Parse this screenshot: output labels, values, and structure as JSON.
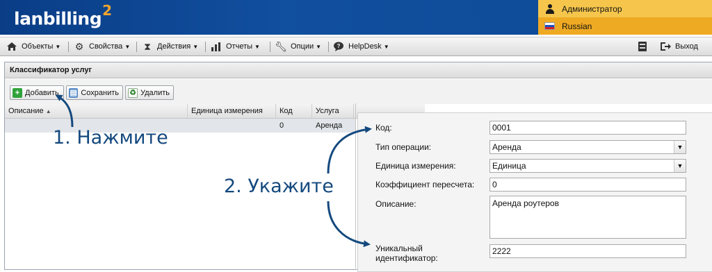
{
  "header": {
    "logo_text": "lanbilling",
    "logo_sup": "2",
    "user": "Администратор",
    "language": "Russian"
  },
  "menu": {
    "items": [
      {
        "label": "Объекты",
        "icon": "building-icon"
      },
      {
        "label": "Свойства",
        "icon": "gear-icon"
      },
      {
        "label": "Действия",
        "icon": "hourglass-icon"
      },
      {
        "label": "Отчеты",
        "icon": "bar-chart-icon"
      },
      {
        "label": "Опции",
        "icon": "wrench-icon"
      },
      {
        "label": "HelpDesk",
        "icon": "chat-icon"
      }
    ],
    "logout_label": "Выход"
  },
  "panel": {
    "title": "Классификатор услуг",
    "toolbar": {
      "add_label": "Добавить",
      "save_label": "Сохранить",
      "delete_label": "Удалить"
    }
  },
  "grid": {
    "columns": [
      "Описание",
      "Единица измерения",
      "Код",
      "Услуга"
    ],
    "rows": [
      {
        "description": "",
        "unit": "",
        "code": "0",
        "service": "Аренда"
      }
    ]
  },
  "form": {
    "code_label": "Код:",
    "code_value": "0001",
    "op_type_label": "Тип операции:",
    "op_type_value": "Аренда",
    "unit_label": "Единица измерения:",
    "unit_value": "Единица",
    "coef_label": "Коэффициент пересчета:",
    "coef_value": "0",
    "desc_label": "Описание:",
    "desc_value": "Аренда роутеров",
    "uid_label_1": "Уникальный",
    "uid_label_2": "идентификатор:",
    "uid_value": "2222"
  },
  "annotations": {
    "step1": "1. Нажмите",
    "step2": "2. Укажите"
  },
  "colors": {
    "header_blue": "#114f9f",
    "user_yellow": "#f6c64c",
    "lang_orange": "#efaa23",
    "annotation_blue": "#14497e"
  }
}
